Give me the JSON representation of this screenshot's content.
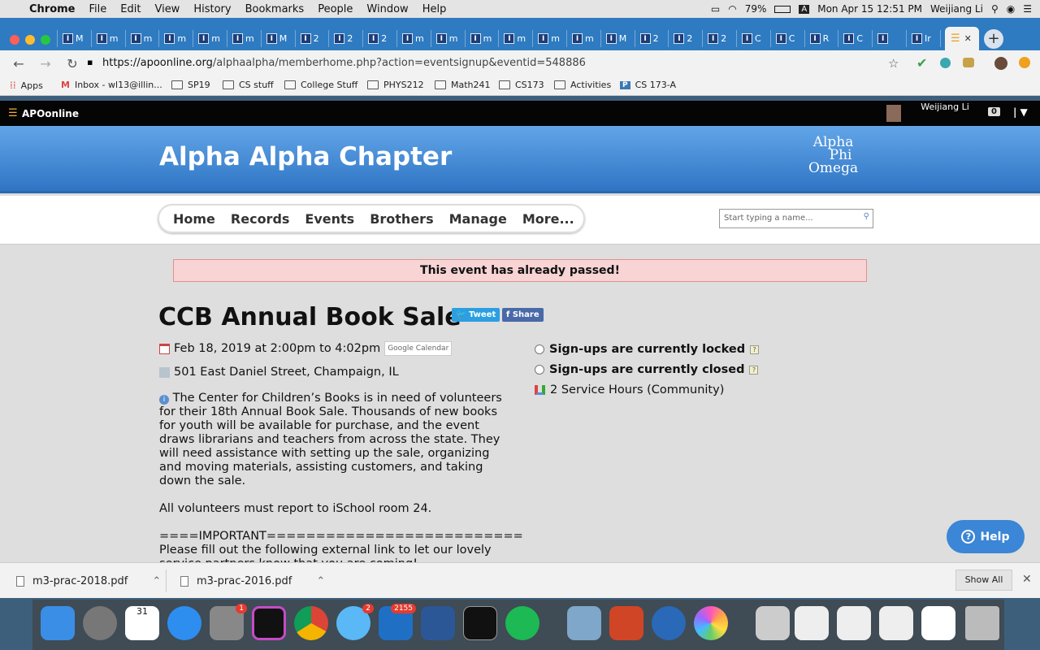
{
  "menubar": {
    "apple": "",
    "app": "Chrome",
    "items": [
      "File",
      "Edit",
      "View",
      "History",
      "Bookmarks",
      "People",
      "Window",
      "Help"
    ],
    "battery": "79%",
    "clock": "Mon Apr 15  12:51 PM",
    "user": "Weijiang Li"
  },
  "tabs": [
    "M",
    "m",
    "m",
    "m",
    "m",
    "m",
    "M",
    "2",
    "2",
    "2",
    "m",
    "m",
    "m",
    "m",
    "m",
    "m",
    "M",
    "2",
    "2",
    "2",
    "C",
    "C",
    "R",
    "C",
    "",
    "Ir",
    "Il"
  ],
  "browser": {
    "url_host": "https://apoonline.org",
    "url_path": "/alphaalpha/memberhome.php?action=eventsignup&eventid=548886"
  },
  "bookmarks": [
    "Apps",
    "Inbox - wl13@illin...",
    "SP19",
    "CS stuff",
    "College Stuff",
    "PHYS212",
    "Math241",
    "CS173",
    "Activities",
    "CS 173-A"
  ],
  "apo": {
    "brand": "APOonline",
    "user": "Weijiang Li",
    "count": "0",
    "chapter": "Alpha Alpha Chapter",
    "logo": [
      "Alpha",
      "Phi",
      "Omega"
    ],
    "nav": [
      "Home",
      "Records",
      "Events",
      "Brothers",
      "Manage",
      "More..."
    ],
    "search_placeholder": "Start typing a name..."
  },
  "event": {
    "alert": "This event has already passed!",
    "title": "CCB Annual Book Sale",
    "tweet": "Tweet",
    "share": "Share",
    "date": "Feb 18, 2019 at 2:00pm to 4:02pm",
    "gcal": "Google Calendar",
    "location": "501 East Daniel Street, Champaign, IL",
    "desc1": "The Center for Children’s Books is in need of volunteers for their 18th Annual Book Sale. Thousands of new books for youth will be available for purchase, and the event draws librarians and teachers from across the state. They will need assistance with setting up the sale, organizing and moving materials, assisting customers, and taking down the sale.",
    "desc2": "All volunteers must report to iSchool room 24.",
    "desc3": "====IMPORTANT==========================",
    "desc4": "Please fill out the following external link to let our lovely service partners know that you are coming!",
    "status1": "Sign-ups are currently locked",
    "status2": "Sign-ups are currently closed",
    "hours": "2 Service Hours (Community)",
    "help": "Help"
  },
  "downloads": {
    "file1": "m3-prac-2018.pdf",
    "file2": "m3-prac-2016.pdf",
    "showall": "Show All"
  },
  "dock": {
    "calendar_day": "31",
    "badge1": "1",
    "badge2": "2",
    "badge3": "2155"
  }
}
